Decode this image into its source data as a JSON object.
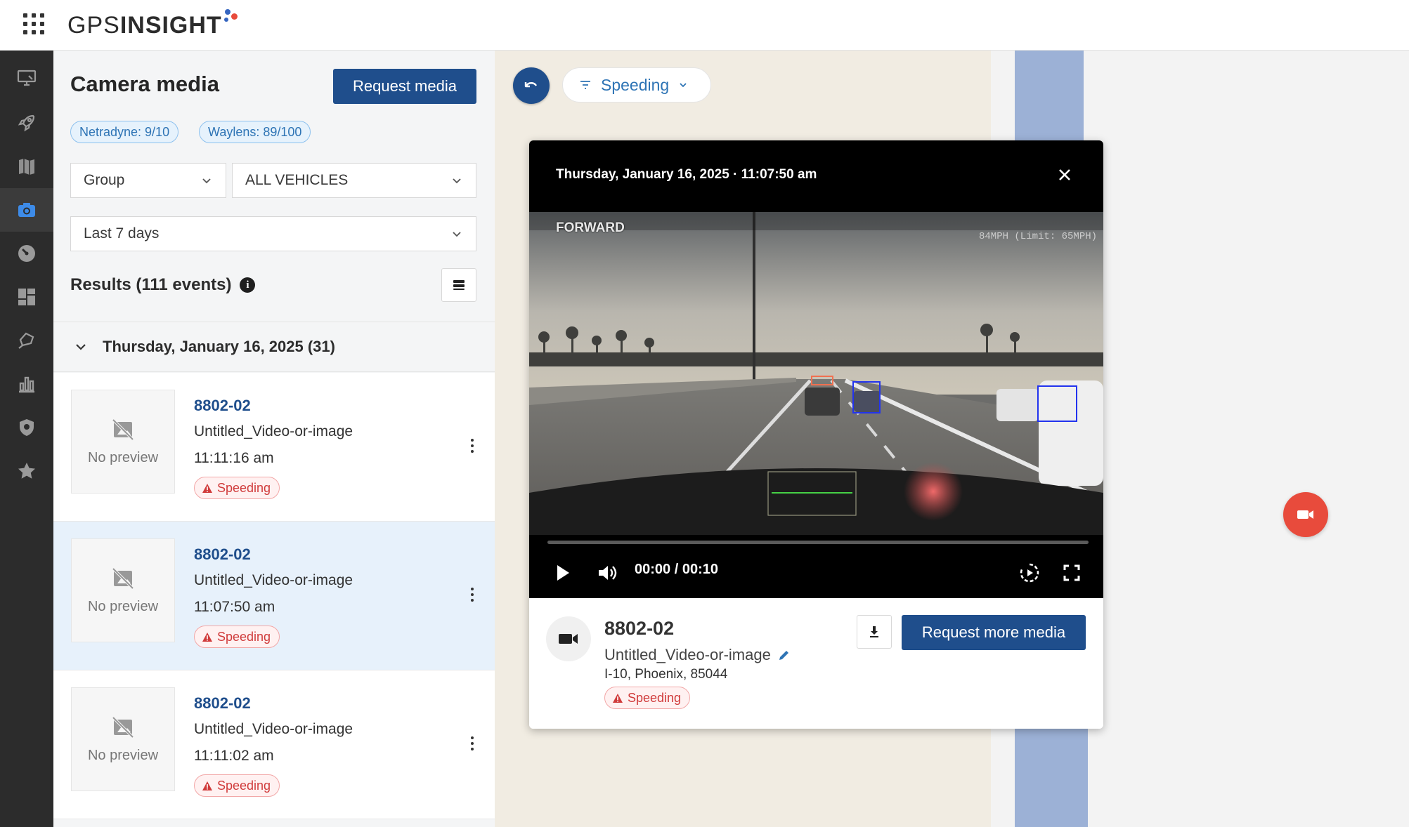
{
  "header": {
    "logo_text_a": "GPS",
    "logo_text_b": "INSIGHT"
  },
  "nav": {
    "items": [
      "display-icon",
      "rocket-icon",
      "map-icon",
      "camera-icon",
      "gauge-icon",
      "dashboard-icon",
      "geofence-icon",
      "reports-icon",
      "shield-icon",
      "star-icon"
    ],
    "active": "camera-icon"
  },
  "panel": {
    "title": "Camera media",
    "request_button": "Request media",
    "chips": [
      "Netradyne: 9/10",
      "Waylens: 89/100"
    ],
    "group_select": "Group",
    "vehicles_select": "ALL VEHICLES",
    "range_select": "Last 7 days",
    "results_label": "Results (111 events)",
    "info_glyph": "i",
    "date_group": "Thursday, January 16, 2025 (31)",
    "no_preview": "No preview",
    "events": [
      {
        "id": "8802-02",
        "name": "Untitled_Video-or-image",
        "time": "11:11:16 am",
        "tag": "Speeding"
      },
      {
        "id": "8802-02",
        "name": "Untitled_Video-or-image",
        "time": "11:07:50 am",
        "tag": "Speeding"
      },
      {
        "id": "8802-02",
        "name": "Untitled_Video-or-image",
        "time": "11:11:02 am",
        "tag": "Speeding"
      }
    ]
  },
  "filter": {
    "label": "Speeding"
  },
  "media": {
    "datetime": "Thursday, January 16, 2025 · 11:07:50 am",
    "camera_view": "FORWARD",
    "overlay_speed": "84MPH (Limit: 65MPH)",
    "time_readout": "00:00 / 00:10",
    "progress": 0,
    "vehicle_id": "8802-02",
    "file_name": "Untitled_Video-or-image",
    "location": "I-10, Phoenix, 85044",
    "tag": "Speeding",
    "request_more_button": "Request more media"
  },
  "colors": {
    "primary": "#1f4e8c",
    "accent_red": "#e84b3c",
    "chip_blue": "#2e74b5",
    "nav_bg": "#2c2c2c",
    "badge_red": "#d03b3b"
  }
}
